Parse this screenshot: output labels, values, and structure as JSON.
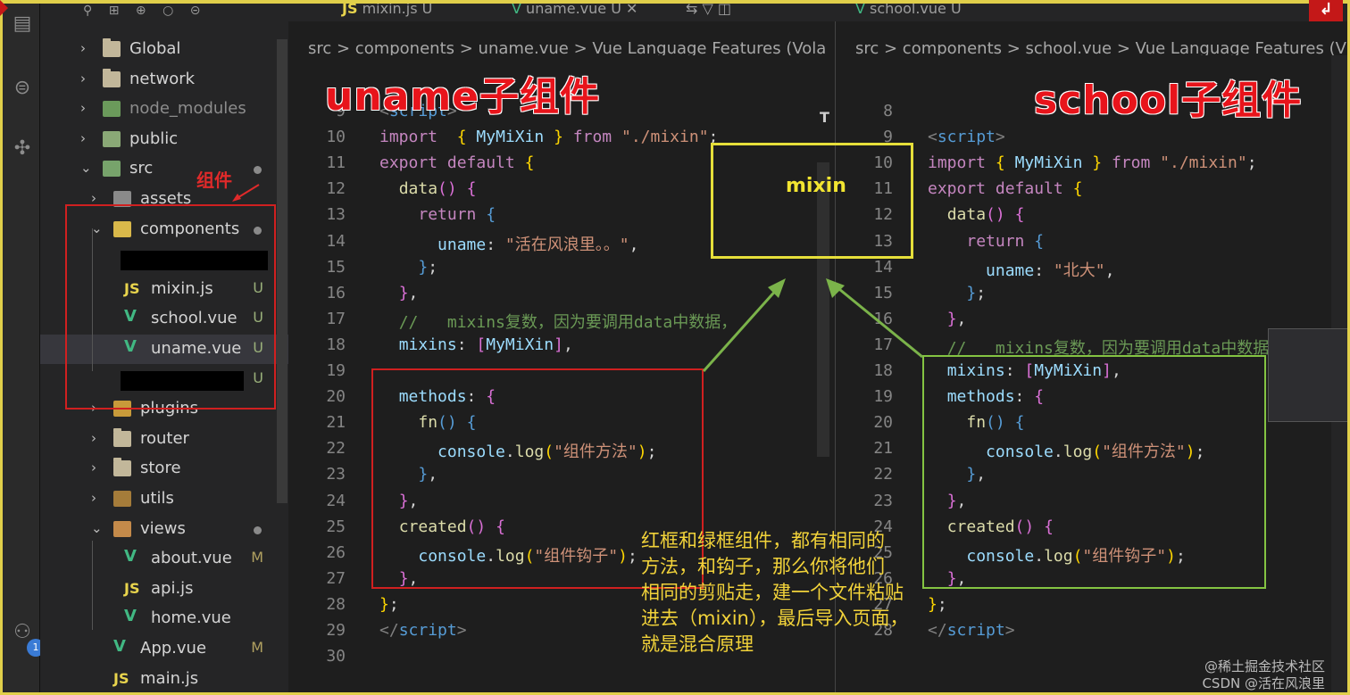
{
  "tabs": [
    {
      "label": "mixin.js",
      "mark": "U"
    },
    {
      "label": "uname.vue",
      "mark": "U"
    },
    {
      "label": "school.vue",
      "mark": "U"
    }
  ],
  "breadcrumb_left": "src > components > uname.vue > Vue Language Features (Vola",
  "breadcrumb_right": "src > components > school.vue > Vue Language Features (V",
  "tree": [
    {
      "label": "Global",
      "type": "folder",
      "depth": 1,
      "open": false
    },
    {
      "label": "network",
      "type": "folder",
      "depth": 1,
      "open": false
    },
    {
      "label": "node_modules",
      "type": "node",
      "depth": 1,
      "open": false
    },
    {
      "label": "public",
      "type": "gear",
      "depth": 1,
      "open": false
    },
    {
      "label": "src",
      "type": "src",
      "depth": 1,
      "open": true,
      "dot": true
    },
    {
      "label": "assets",
      "type": "assets",
      "depth": 2,
      "open": false
    },
    {
      "label": "components",
      "type": "comp",
      "depth": 2,
      "open": true,
      "dot": true
    },
    {
      "label": "",
      "type": "redacted",
      "depth": 3
    },
    {
      "label": "mixin.js",
      "type": "js",
      "depth": 3,
      "status": "U"
    },
    {
      "label": "school.vue",
      "type": "vue",
      "depth": 3,
      "status": "U"
    },
    {
      "label": "uname.vue",
      "type": "vue",
      "depth": 3,
      "status": "U",
      "selected": true
    },
    {
      "label": "",
      "type": "redacted",
      "depth": 3,
      "status": "U"
    },
    {
      "label": "plugins",
      "type": "plug",
      "depth": 2,
      "open": false
    },
    {
      "label": "router",
      "type": "folder",
      "depth": 2,
      "open": false
    },
    {
      "label": "store",
      "type": "folder",
      "depth": 2,
      "open": false
    },
    {
      "label": "utils",
      "type": "util",
      "depth": 2,
      "open": false
    },
    {
      "label": "views",
      "type": "views",
      "depth": 2,
      "open": true,
      "dot": true
    },
    {
      "label": "about.vue",
      "type": "vue",
      "depth": 3,
      "status": "M"
    },
    {
      "label": "api.js",
      "type": "js",
      "depth": 3
    },
    {
      "label": "home.vue",
      "type": "vue",
      "depth": 3
    },
    {
      "label": "App.vue",
      "type": "vue",
      "depth": 2,
      "status": "M"
    },
    {
      "label": "main.js",
      "type": "js",
      "depth": 2
    }
  ],
  "sidebar_note": "组件",
  "left_code": {
    "start": 9,
    "lines": [
      [
        [
          "tag",
          "<"
        ],
        [
          "kw",
          "script"
        ],
        [
          "tag",
          ">"
        ]
      ],
      [
        [
          "ctl",
          "import"
        ],
        [
          "",
          "  "
        ],
        [
          "br",
          "{"
        ],
        [
          "",
          " "
        ],
        [
          "prop",
          "MyMiXin"
        ],
        [
          "",
          " "
        ],
        [
          "br",
          "}"
        ],
        [
          "",
          " "
        ],
        [
          "ctl",
          "from"
        ],
        [
          "",
          " "
        ],
        [
          "str",
          "\"./mixin\""
        ],
        [
          "",
          ";"
        ]
      ],
      [
        [
          "ctl",
          "export"
        ],
        [
          "",
          " "
        ],
        [
          "ctl",
          "default"
        ],
        [
          "",
          " "
        ],
        [
          "br",
          "{"
        ]
      ],
      [
        [
          "",
          "  "
        ],
        [
          "fn",
          "data"
        ],
        [
          "br2",
          "()"
        ],
        [
          "",
          " "
        ],
        [
          "br2",
          "{"
        ]
      ],
      [
        [
          "",
          "    "
        ],
        [
          "ctl",
          "return"
        ],
        [
          "",
          " "
        ],
        [
          "kw",
          "{"
        ]
      ],
      [
        [
          "",
          "      "
        ],
        [
          "prop",
          "uname"
        ],
        [
          "",
          ": "
        ],
        [
          "str",
          "\"活在风浪里。。\""
        ],
        [
          "",
          ","
        ]
      ],
      [
        [
          "",
          "    "
        ],
        [
          "kw",
          "}"
        ],
        [
          "",
          ";"
        ]
      ],
      [
        [
          "",
          "  "
        ],
        [
          "br2",
          "}"
        ],
        [
          "",
          ","
        ]
      ],
      [
        [
          "",
          "  "
        ],
        [
          "cmt",
          "//   mixins复数，因为要调用data中数据，"
        ]
      ],
      [
        [
          "",
          "  "
        ],
        [
          "prop",
          "mixins"
        ],
        [
          "",
          ": "
        ],
        [
          "br2",
          "["
        ],
        [
          "prop",
          "MyMiXin"
        ],
        [
          "br2",
          "]"
        ],
        [
          "",
          ","
        ]
      ],
      [
        [
          "",
          ""
        ]
      ],
      [
        [
          "",
          "  "
        ],
        [
          "prop",
          "methods"
        ],
        [
          "",
          ": "
        ],
        [
          "br2",
          "{"
        ]
      ],
      [
        [
          "",
          "    "
        ],
        [
          "fn",
          "fn"
        ],
        [
          "kw",
          "()"
        ],
        [
          "",
          " "
        ],
        [
          "kw",
          "{"
        ]
      ],
      [
        [
          "",
          "      "
        ],
        [
          "prop",
          "console"
        ],
        [
          "",
          "."
        ],
        [
          "fn",
          "log"
        ],
        [
          "br",
          "("
        ],
        [
          "str",
          "\"组件方法\""
        ],
        [
          "br",
          ")"
        ],
        [
          "",
          ";"
        ]
      ],
      [
        [
          "",
          "    "
        ],
        [
          "kw",
          "}"
        ],
        [
          "",
          ","
        ]
      ],
      [
        [
          "",
          "  "
        ],
        [
          "br2",
          "}"
        ],
        [
          "",
          ","
        ]
      ],
      [
        [
          "",
          "  "
        ],
        [
          "fn",
          "created"
        ],
        [
          "br2",
          "()"
        ],
        [
          "",
          " "
        ],
        [
          "br2",
          "{"
        ]
      ],
      [
        [
          "",
          "    "
        ],
        [
          "prop",
          "console"
        ],
        [
          "",
          "."
        ],
        [
          "fn",
          "log"
        ],
        [
          "br",
          "("
        ],
        [
          "str",
          "\"组件钩子\""
        ],
        [
          "br",
          ")"
        ],
        [
          "",
          ";"
        ]
      ],
      [
        [
          "",
          "  "
        ],
        [
          "br2",
          "}"
        ],
        [
          "",
          ","
        ]
      ],
      [
        [
          "br",
          "}"
        ],
        [
          "",
          ";"
        ]
      ],
      [
        [
          "tag",
          "</"
        ],
        [
          "kw",
          "script"
        ],
        [
          "tag",
          ">"
        ]
      ],
      [
        [
          "",
          ""
        ]
      ]
    ]
  },
  "right_code": {
    "start": 8,
    "lines": [
      [
        [
          "",
          ""
        ]
      ],
      [
        [
          "tag",
          "<"
        ],
        [
          "kw",
          "script"
        ],
        [
          "tag",
          ">"
        ]
      ],
      [
        [
          "ctl",
          "import"
        ],
        [
          "",
          " "
        ],
        [
          "br",
          "{"
        ],
        [
          "",
          " "
        ],
        [
          "prop",
          "MyMiXin"
        ],
        [
          "",
          " "
        ],
        [
          "br",
          "}"
        ],
        [
          "",
          " "
        ],
        [
          "ctl",
          "from"
        ],
        [
          "",
          " "
        ],
        [
          "str",
          "\"./mixin\""
        ],
        [
          "",
          ";"
        ]
      ],
      [
        [
          "ctl",
          "export"
        ],
        [
          "",
          " "
        ],
        [
          "ctl",
          "default"
        ],
        [
          "",
          " "
        ],
        [
          "br",
          "{"
        ]
      ],
      [
        [
          "",
          "  "
        ],
        [
          "fn",
          "data"
        ],
        [
          "br2",
          "()"
        ],
        [
          "",
          " "
        ],
        [
          "br2",
          "{"
        ]
      ],
      [
        [
          "",
          "    "
        ],
        [
          "ctl",
          "return"
        ],
        [
          "",
          " "
        ],
        [
          "kw",
          "{"
        ]
      ],
      [
        [
          "",
          "      "
        ],
        [
          "prop",
          "uname"
        ],
        [
          "",
          ": "
        ],
        [
          "str",
          "\"北大\""
        ],
        [
          "",
          ","
        ]
      ],
      [
        [
          "",
          "    "
        ],
        [
          "kw",
          "}"
        ],
        [
          "",
          ";"
        ]
      ],
      [
        [
          "",
          "  "
        ],
        [
          "br2",
          "}"
        ],
        [
          "",
          ","
        ]
      ],
      [
        [
          "",
          "  "
        ],
        [
          "cmt",
          "//   mixins复数，因为要调用data中数据，"
        ]
      ],
      [
        [
          "",
          "  "
        ],
        [
          "prop",
          "mixins"
        ],
        [
          "",
          ": "
        ],
        [
          "br2",
          "["
        ],
        [
          "prop",
          "MyMiXin"
        ],
        [
          "br2",
          "]"
        ],
        [
          "",
          ","
        ]
      ],
      [
        [
          "",
          "  "
        ],
        [
          "prop",
          "methods"
        ],
        [
          "",
          ": "
        ],
        [
          "br2",
          "{"
        ]
      ],
      [
        [
          "",
          "    "
        ],
        [
          "fn",
          "fn"
        ],
        [
          "kw",
          "()"
        ],
        [
          "",
          " "
        ],
        [
          "kw",
          "{"
        ]
      ],
      [
        [
          "",
          "      "
        ],
        [
          "prop",
          "console"
        ],
        [
          "",
          "."
        ],
        [
          "fn",
          "log"
        ],
        [
          "br",
          "("
        ],
        [
          "str",
          "\"组件方法\""
        ],
        [
          "br",
          ")"
        ],
        [
          "",
          ";"
        ]
      ],
      [
        [
          "",
          "    "
        ],
        [
          "kw",
          "}"
        ],
        [
          "",
          ","
        ]
      ],
      [
        [
          "",
          "  "
        ],
        [
          "br2",
          "}"
        ],
        [
          "",
          ","
        ]
      ],
      [
        [
          "",
          "  "
        ],
        [
          "fn",
          "created"
        ],
        [
          "br2",
          "()"
        ],
        [
          "",
          " "
        ],
        [
          "br2",
          "{"
        ]
      ],
      [
        [
          "",
          "    "
        ],
        [
          "prop",
          "console"
        ],
        [
          "",
          "."
        ],
        [
          "fn",
          "log"
        ],
        [
          "br",
          "("
        ],
        [
          "str",
          "\"组件钩子\""
        ],
        [
          "br",
          ")"
        ],
        [
          "",
          ";"
        ]
      ],
      [
        [
          "",
          "  "
        ],
        [
          "br2",
          "}"
        ],
        [
          "",
          ","
        ]
      ],
      [
        [
          "br",
          "}"
        ],
        [
          "",
          ";"
        ]
      ],
      [
        [
          "tag",
          "</"
        ],
        [
          "kw",
          "script"
        ],
        [
          "tag",
          ">"
        ]
      ]
    ]
  },
  "title_left": "uname子组件",
  "title_right": "school子组件",
  "mixin_label": "mixin",
  "note": [
    "红框和绿框组件，都有相同的",
    "方法，和钩子，那么你将他们",
    "相同的剪贴走，建一个文件粘贴",
    "进去（mixin），最后导入页面，",
    "就是混合原理"
  ],
  "watermark1": "@稀土掘金技术社区",
  "watermark2": "CSDN @活在风浪里",
  "activity_badge": "1",
  "colors": {
    "red": "#e8141b",
    "yellow": "#e6df3a",
    "green": "#84c442",
    "frame": "#e0cf4a"
  }
}
